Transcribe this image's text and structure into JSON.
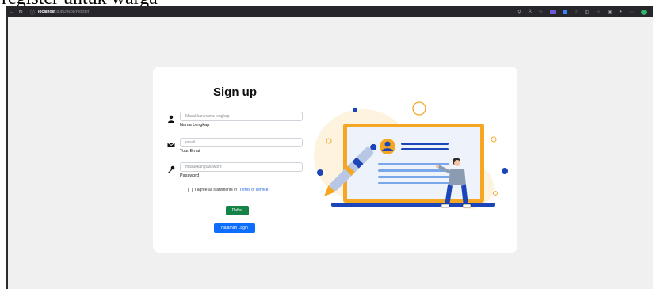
{
  "caption": "register untuk warga",
  "browser": {
    "url_host": "localhost",
    "url_path": ":8080/skpp/register"
  },
  "form": {
    "title": "Sign up",
    "name_placeholder": "Masukkan nama lengkap",
    "name_label": "Nama Lengkap",
    "email_placeholder": "email",
    "email_label": "Your Email",
    "password_placeholder": "masukkan password",
    "password_label": "Password",
    "agree_text": "I agree all statements in",
    "terms_link": "Terms of service",
    "daftar_label": "Daftar",
    "login_label": "Halaman Login"
  },
  "colors": {
    "daftar": "#168346",
    "login": "#0d6efd",
    "illustration_blue": "#1b45b8",
    "illustration_orange": "#f5a623"
  }
}
